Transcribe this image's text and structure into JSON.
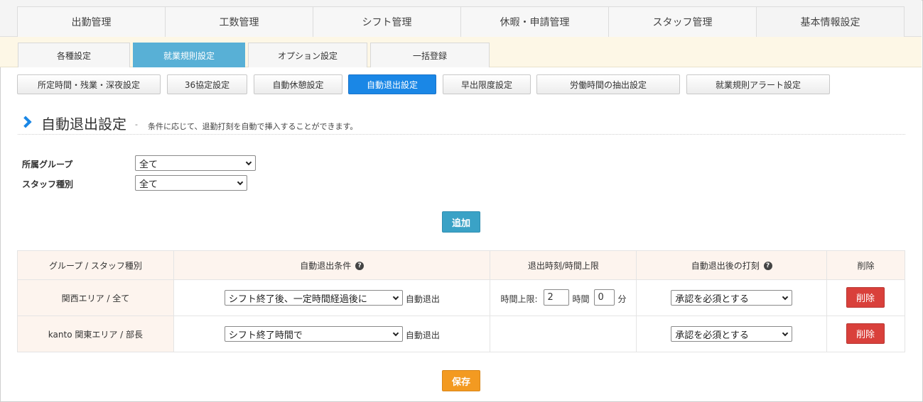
{
  "top_nav": [
    {
      "label": "出勤管理"
    },
    {
      "label": "工数管理"
    },
    {
      "label": "シフト管理"
    },
    {
      "label": "休暇・申請管理"
    },
    {
      "label": "スタッフ管理"
    },
    {
      "label": "基本情報設定",
      "active": true
    }
  ],
  "sub_nav": [
    {
      "label": "各種設定"
    },
    {
      "label": "就業規則設定",
      "active": true
    },
    {
      "label": "オプション設定"
    },
    {
      "label": "一括登録"
    }
  ],
  "rule_nav": [
    {
      "label": "所定時間・残業・深夜設定"
    },
    {
      "label": "36協定設定"
    },
    {
      "label": "自動休憩設定"
    },
    {
      "label": "自動退出設定",
      "active": true
    },
    {
      "label": "早出限度設定"
    },
    {
      "label": "労働時間の抽出設定"
    },
    {
      "label": "就業規則アラート設定"
    }
  ],
  "page": {
    "title": "自動退出設定",
    "dash": "-",
    "subtitle": "条件に応じて、退勤打刻を自動で挿入することができます。"
  },
  "filters": {
    "group_label": "所属グループ",
    "group_value": "全て",
    "staff_type_label": "スタッフ種別",
    "staff_type_value": "全て"
  },
  "add_button": "追加",
  "table": {
    "headers": {
      "group": "グループ / スタッフ種別",
      "condition": "自動退出条件",
      "time": "退出時刻/時間上限",
      "after": "自動退出後の打刻",
      "delete": "削除"
    },
    "rows": [
      {
        "group": "関西エリア / 全て",
        "condition": "シフト終了後、一定時間経過後に",
        "condition_suffix": "自動退出",
        "time_limit_label": "時間上限:",
        "hours": "2",
        "hours_unit": "時間",
        "minutes": "0",
        "minutes_unit": "分",
        "after": "承認を必須とする",
        "delete": "削除"
      },
      {
        "group": "kanto 関東エリア / 部長",
        "condition": "シフト終了時間で",
        "condition_suffix": "自動退出",
        "after": "承認を必須とする",
        "delete": "削除"
      }
    ]
  },
  "save_button": "保存",
  "icons": {
    "heading": "chevron-right-icon",
    "help": "question-circle-icon",
    "dropdown": "chevron-down-icon"
  },
  "colors": {
    "active_subtab": "#58b0d6",
    "active_rule": "#1a87e6",
    "add_button": "#3aa2c6",
    "delete_button": "#d9403b",
    "save_button": "#f39a21"
  }
}
